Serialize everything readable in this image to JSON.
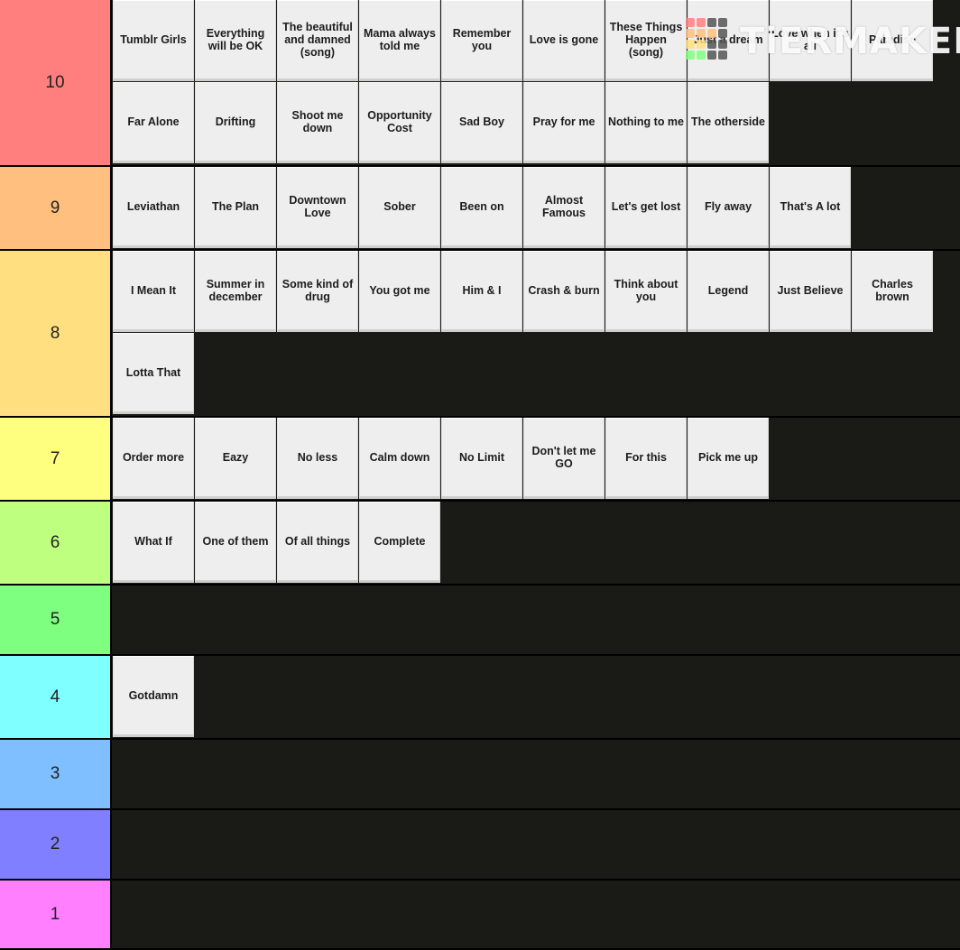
{
  "watermark": {
    "text": "TiERMAKER",
    "grid_colors": [
      "#ff7f7f",
      "#ff7f7f",
      "#555555",
      "#555555",
      "#ffbf7f",
      "#ffbf7f",
      "#ffbf7f",
      "#555555",
      "#ffdf7f",
      "#ffdf7f",
      "#555555",
      "#555555",
      "#7fff7f",
      "#7fff7f",
      "#555555",
      "#555555"
    ]
  },
  "tiers": [
    {
      "label": "10",
      "color": "#ff7f7f",
      "items": [
        "Tumblr Girls",
        "Everything will be OK",
        "The beautiful and damned (song)",
        "Mama always told me",
        "Remember you",
        "Love is gone",
        "These Things Happen (song)",
        "Just a dream",
        "Love when it's all",
        "Paradise",
        "Far Alone",
        "Drifting",
        "Shoot me down",
        "Opportunity Cost",
        "Sad Boy",
        "Pray for me",
        "Nothing to me",
        "The otherside"
      ]
    },
    {
      "label": "9",
      "color": "#ffbf7f",
      "items": [
        "Leviathan",
        "The Plan",
        "Downtown Love",
        "Sober",
        "Been on",
        "Almost Famous",
        "Let's get lost",
        "Fly away",
        "That's A lot"
      ]
    },
    {
      "label": "8",
      "color": "#ffdf7f",
      "items": [
        "I Mean It",
        "Summer in december",
        "Some kind of drug",
        "You got me",
        "Him & I",
        "Crash & burn",
        "Think about you",
        "Legend",
        "Just Believe",
        "Charles brown",
        "Lotta That"
      ]
    },
    {
      "label": "7",
      "color": "#ffff7f",
      "items": [
        "Order more",
        "Eazy",
        "No less",
        "Calm down",
        "No Limit",
        "Don't let me GO",
        "For this",
        "Pick me up"
      ]
    },
    {
      "label": "6",
      "color": "#bfff7f",
      "items": [
        "What If",
        "One of them",
        "Of all things",
        "Complete"
      ]
    },
    {
      "label": "5",
      "color": "#7fff7f",
      "items": []
    },
    {
      "label": "4",
      "color": "#7fffff",
      "items": [
        "Gotdamn"
      ]
    },
    {
      "label": "3",
      "color": "#7fbfff",
      "items": []
    },
    {
      "label": "2",
      "color": "#7f7fff",
      "items": []
    },
    {
      "label": "1",
      "color": "#ff7fff",
      "items": []
    }
  ]
}
